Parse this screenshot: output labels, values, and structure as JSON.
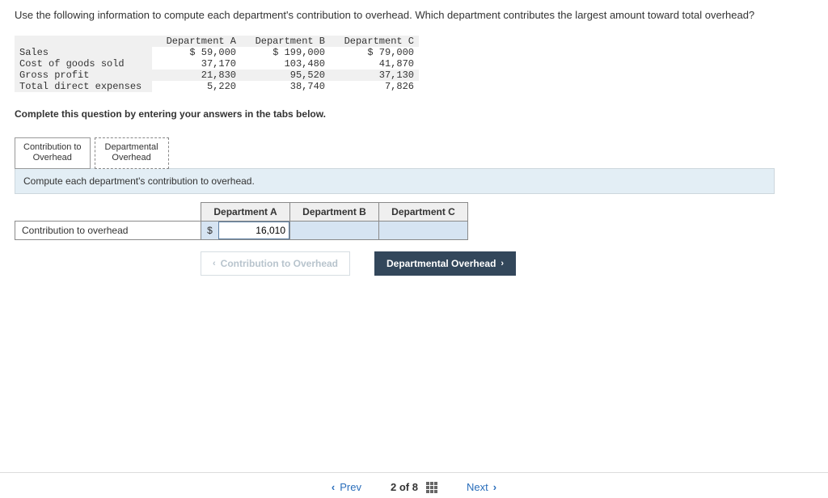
{
  "question": "Use the following information to compute each department's contribution to overhead. Which department contributes the largest amount toward total overhead?",
  "dataTable": {
    "headers": [
      "",
      "Department A",
      "Department B",
      "Department C"
    ],
    "rows": [
      {
        "label": "Sales",
        "a": "$ 59,000",
        "b": "$ 199,000",
        "c": "$ 79,000"
      },
      {
        "label": "Cost of goods sold",
        "a": "37,170",
        "b": "103,480",
        "c": "41,870"
      },
      {
        "label": "Gross profit",
        "a": "21,830",
        "b": "95,520",
        "c": "37,130"
      },
      {
        "label": "Total direct expenses",
        "a": "5,220",
        "b": "38,740",
        "c": "7,826"
      }
    ]
  },
  "instruction": "Complete this question by entering your answers in the tabs below.",
  "tabs": {
    "t1a": "Contribution to",
    "t1b": "Overhead",
    "t2a": "Departmental",
    "t2b": "Overhead"
  },
  "subprompt": "Compute each department's contribution to overhead.",
  "answerTable": {
    "colA": "Department A",
    "colB": "Department B",
    "colC": "Department C",
    "rowLabel": "Contribution to overhead",
    "currency": "$",
    "valueA": "16,010"
  },
  "navButtons": {
    "prev": "Contribution to Overhead",
    "next": "Departmental Overhead"
  },
  "footer": {
    "prev": "Prev",
    "next": "Next",
    "page": "2",
    "of": "of",
    "total": "8"
  }
}
